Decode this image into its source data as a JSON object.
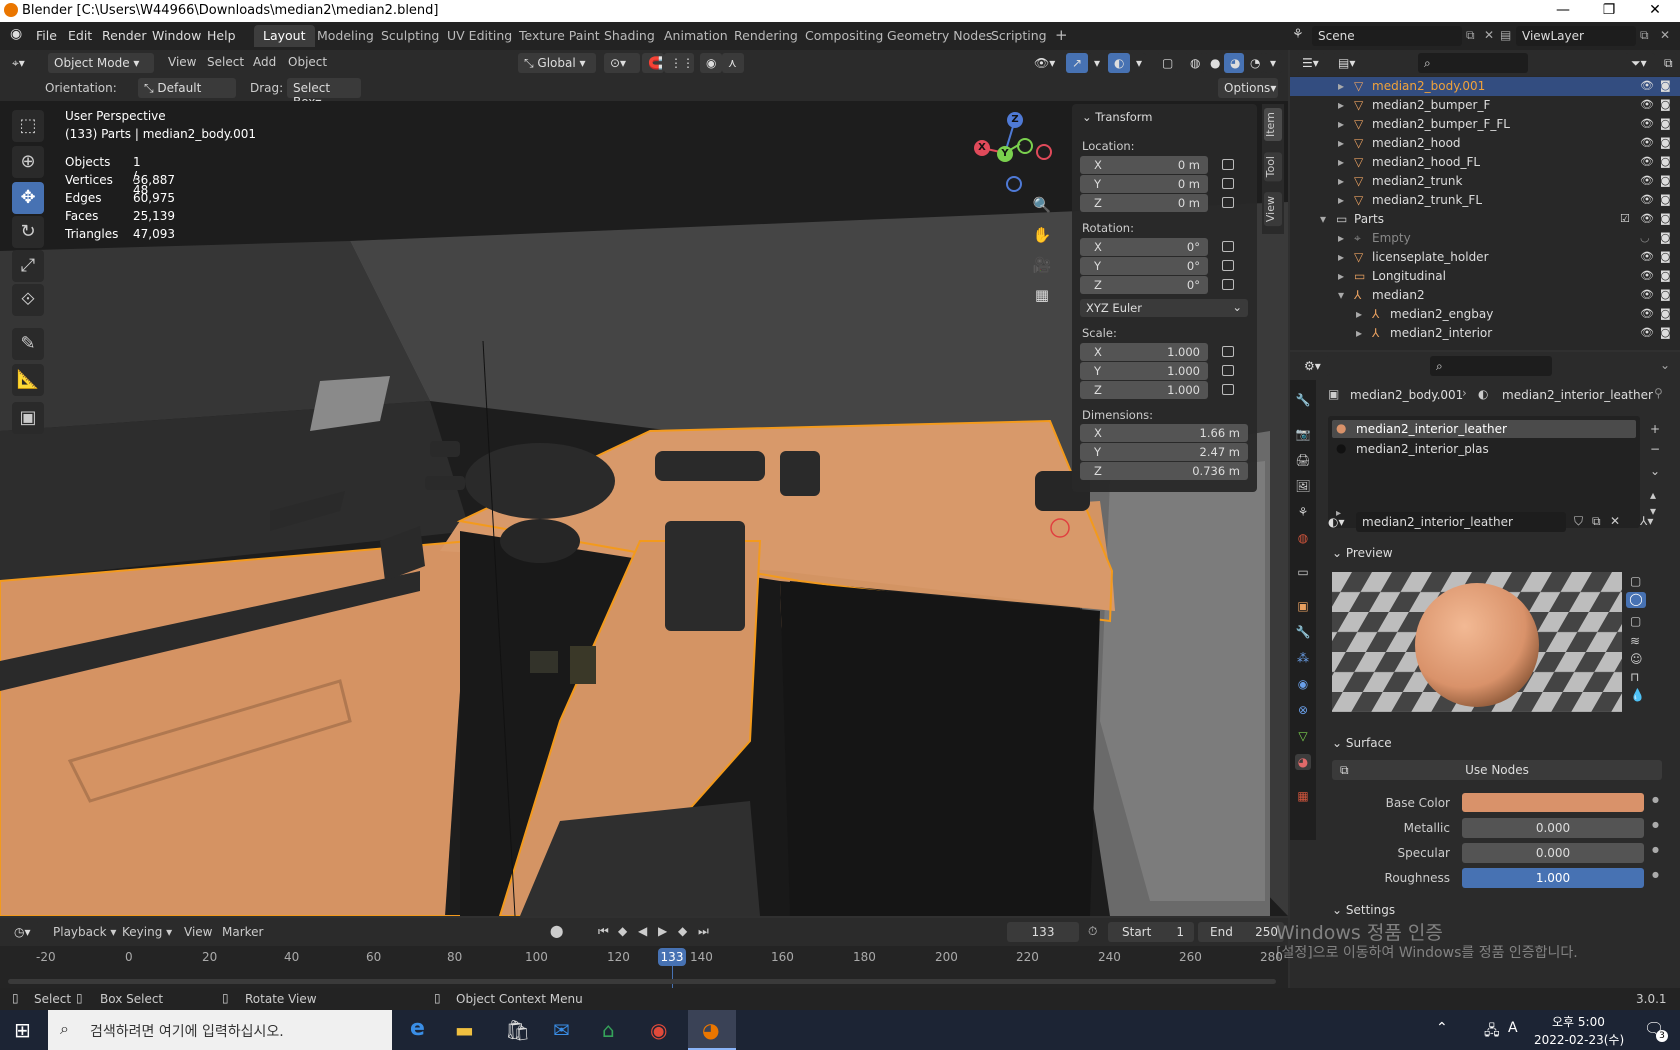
{
  "window": {
    "title": "Blender [C:\\Users\\W44966\\Downloads\\median2\\median2.blend]"
  },
  "menu": [
    "File",
    "Edit",
    "Render",
    "Window",
    "Help"
  ],
  "workspaces": [
    "Layout",
    "Modeling",
    "Sculpting",
    "UV Editing",
    "Texture Paint",
    "Shading",
    "Animation",
    "Rendering",
    "Compositing",
    "Geometry Nodes",
    "Scripting"
  ],
  "scene": {
    "name": "Scene",
    "view_layer": "ViewLayer"
  },
  "header": {
    "mode": "Object Mode",
    "view": "View",
    "select": "Select",
    "add": "Add",
    "object": "Object",
    "transform": "Global",
    "orientation_label": "Orientation:",
    "orientation": "Default",
    "drag_label": "Drag:",
    "drag": "Select Box",
    "options": "Options"
  },
  "viewport": {
    "perspective": "User Perspective",
    "context": "(133) Parts | median2_body.001",
    "stats": [
      {
        "label": "Objects",
        "value": "1 / 48"
      },
      {
        "label": "Vertices",
        "value": "36,887"
      },
      {
        "label": "Edges",
        "value": "60,975"
      },
      {
        "label": "Faces",
        "value": "25,139"
      },
      {
        "label": "Triangles",
        "value": "47,093"
      }
    ]
  },
  "transform": {
    "title": "Transform",
    "location_label": "Location:",
    "location": {
      "x": "0 m",
      "y": "0 m",
      "z": "0 m"
    },
    "rotation_label": "Rotation:",
    "rotation": {
      "x": "0°",
      "y": "0°",
      "z": "0°"
    },
    "rotation_mode": "XYZ Euler",
    "scale_label": "Scale:",
    "scale": {
      "x": "1.000",
      "y": "1.000",
      "z": "1.000"
    },
    "dimensions_label": "Dimensions:",
    "dimensions": {
      "x": "1.66 m",
      "y": "2.47 m",
      "z": "0.736 m"
    },
    "axes": {
      "x": "X",
      "y": "Y",
      "z": "Z"
    }
  },
  "ntabs": [
    "Item",
    "Tool",
    "View"
  ],
  "outliner": [
    {
      "name": "median2_body.001",
      "selected": true
    },
    {
      "name": "median2_bumper_F"
    },
    {
      "name": "median2_bumper_F_FL"
    },
    {
      "name": "median2_hood"
    },
    {
      "name": "median2_hood_FL"
    },
    {
      "name": "median2_trunk"
    },
    {
      "name": "median2_trunk_FL"
    },
    {
      "name": "Parts"
    },
    {
      "name": "Empty"
    },
    {
      "name": "licenseplate_holder"
    },
    {
      "name": "Longitudinal"
    },
    {
      "name": "median2"
    },
    {
      "name": "median2_engbay"
    },
    {
      "name": "median2_interior"
    }
  ],
  "properties": {
    "breadcrumb_object": "median2_body.001",
    "breadcrumb_material": "median2_interior_leather",
    "slots": [
      "median2_interior_leather",
      "median2_interior_plas"
    ],
    "material_name": "median2_interior_leather",
    "preview_label": "Preview",
    "surface_label": "Surface",
    "use_nodes": "Use Nodes",
    "base_color_label": "Base Color",
    "base_color": "#d9926a",
    "metallic_label": "Metallic",
    "metallic": "0.000",
    "specular_label": "Specular",
    "specular": "0.000",
    "roughness_label": "Roughness",
    "roughness": "1.000",
    "settings_label": "Settings"
  },
  "timeline": {
    "playback": "Playback",
    "keying": "Keying",
    "view": "View",
    "marker": "Marker",
    "current_frame": "133",
    "start_label": "Start",
    "start": "1",
    "end_label": "End",
    "end": "250",
    "ticks": [
      "-20",
      "0",
      "20",
      "40",
      "60",
      "80",
      "100",
      "120",
      "140",
      "160",
      "180",
      "200",
      "220",
      "240",
      "260",
      "280"
    ]
  },
  "status": {
    "select": "Select",
    "box_select": "Box Select",
    "rotate": "Rotate View",
    "context_menu": "Object Context Menu",
    "version": "3.0.1"
  },
  "watermark": {
    "line1": "Windows 정품 인증",
    "line2": "[설정]으로 이동하여 Windows를 정품 인증합니다."
  },
  "taskbar": {
    "search_placeholder": "검색하려면 여기에 입력하십시오.",
    "time": "오후 5:00",
    "date": "2022-02-23(수)",
    "ime": "A",
    "notifications": "3"
  }
}
